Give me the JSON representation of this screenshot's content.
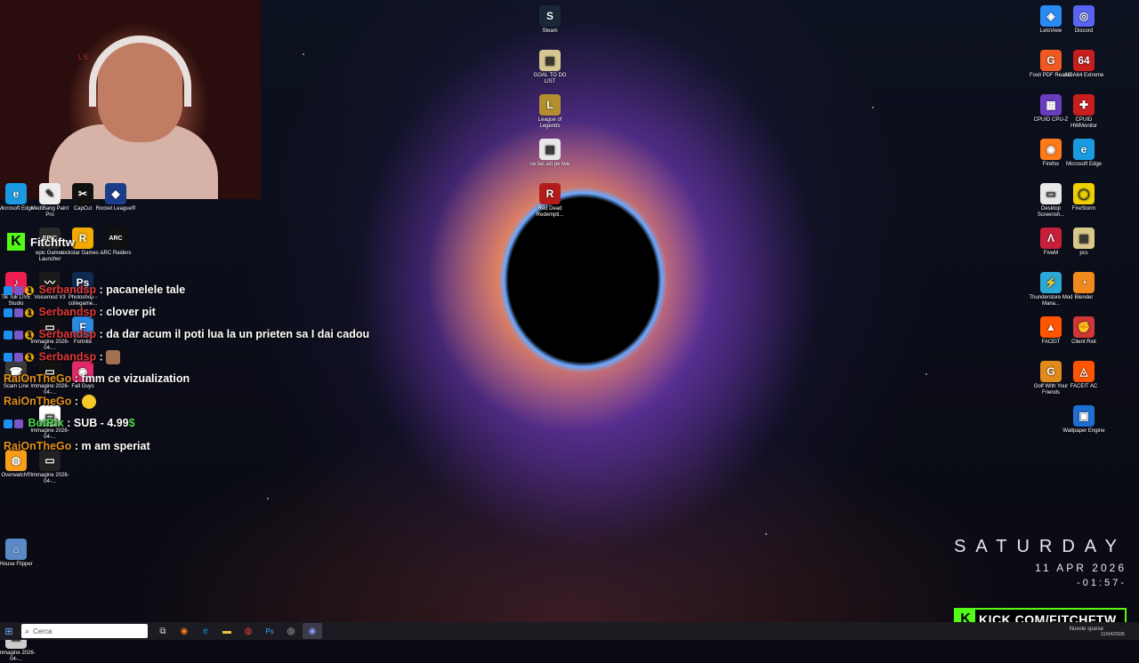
{
  "overlay": {
    "kick_chat_username": "Fitchftw",
    "kick_banner_url": "KICK.COM/FITCHFTW"
  },
  "desktop": {
    "top_center_icons": [
      {
        "label": "Steam",
        "color": "#1b2838",
        "glyph": "S"
      },
      {
        "label": "GOAL TO DO LIST",
        "color": "#d6c690",
        "glyph": "▤"
      },
      {
        "label": "League of Legends",
        "color": "#b38e2e",
        "glyph": "L"
      },
      {
        "label": "ce fac azi pe live",
        "color": "#e8e8e8",
        "glyph": "▤"
      },
      {
        "label": "Red Dead Redempti...",
        "color": "#b31b1b",
        "glyph": "R"
      }
    ],
    "right_col_a": [
      {
        "label": "LetsView",
        "color": "#2a8bf2",
        "glyph": "◈"
      },
      {
        "label": "Foxit PDF Reader",
        "color": "#f05a22",
        "glyph": "G"
      },
      {
        "label": "CPUID CPU-Z",
        "color": "#6a3dbf",
        "glyph": "▦"
      },
      {
        "label": "Firefox",
        "color": "#ff7a18",
        "glyph": "◉"
      },
      {
        "label": "Desktop Screensh...",
        "color": "#e8e8e8",
        "glyph": "▭"
      },
      {
        "label": "FiveM",
        "color": "#c8203a",
        "glyph": "Λ"
      },
      {
        "label": "Thunderstore Mod Mana...",
        "color": "#2aa8d8",
        "glyph": "⚡"
      },
      {
        "label": "FACEIT",
        "color": "#ff5500",
        "glyph": "▲"
      },
      {
        "label": "Golf With Your Friends",
        "color": "#e08a1c",
        "glyph": "G"
      }
    ],
    "right_col_b": [
      {
        "label": "Discord",
        "color": "#5865f2",
        "glyph": "◎"
      },
      {
        "label": "AIDA64 Extreme",
        "color": "#c81e1e",
        "glyph": "64"
      },
      {
        "label": "CPUID HWMonitor",
        "color": "#c81e1e",
        "glyph": "✚"
      },
      {
        "label": "Microsoft Edge",
        "color": "#1a9ae0",
        "glyph": "e"
      },
      {
        "label": "FireStorm",
        "color": "#f0d000",
        "glyph": "◯"
      },
      {
        "label": "pcs",
        "color": "#d8c88a",
        "glyph": "▤"
      },
      {
        "label": "Blender",
        "color": "#f08a1c",
        "glyph": "◔"
      },
      {
        "label": "Client Riot",
        "color": "#d13639",
        "glyph": "✊"
      },
      {
        "label": "FACEIT AC",
        "color": "#ff5500",
        "glyph": "◬"
      },
      {
        "label": "Wallpaper Engine",
        "color": "#1f6ed4",
        "glyph": "▣"
      }
    ],
    "left_col_a": [
      {
        "label": "Microsoft Edge",
        "color": "#1a9ae0",
        "glyph": "e"
      },
      {
        "label": "Tik Tok LIVE Studio",
        "color": "#ee1d52",
        "glyph": "♪"
      },
      {
        "label": "Scam Line",
        "color": "#3a3a3a",
        "glyph": "☎"
      },
      {
        "label": "Overwatch®",
        "color": "#f99e1a",
        "glyph": "◍"
      },
      {
        "label": "House Flipper",
        "color": "#5a8ac6",
        "glyph": "⌂"
      },
      {
        "label": "Immagine 2026-04-...",
        "color": "#cccccc",
        "glyph": "▭"
      }
    ],
    "left_col_b": [
      {
        "label": "MediBang Paint Pro",
        "color": "#eeeeee",
        "glyph": "✎"
      },
      {
        "label": "epic Games Launcher",
        "color": "#2a2a2a",
        "glyph": "EPIC"
      },
      {
        "label": "Voicemod V3",
        "color": "#1a1a1a",
        "glyph": "〰"
      },
      {
        "label": "Immagine 2026-04-...",
        "color": "#111111",
        "glyph": "▭"
      },
      {
        "label": "Immagine 2026-04-...",
        "color": "#111111",
        "glyph": "▭"
      },
      {
        "label": "Immagine 2026-04-...",
        "color": "#ffffff",
        "glyph": "▭"
      },
      {
        "label": "Immagine 2026-04-...",
        "color": "#222222",
        "glyph": "▭"
      }
    ],
    "left_col_c": [
      {
        "label": "CapCut",
        "color": "#111111",
        "glyph": "✂"
      },
      {
        "label": "rockstar Games ...",
        "color": "#f2a900",
        "glyph": "R"
      },
      {
        "label": "Photoshop - collegame...",
        "color": "#0d2b4f",
        "glyph": "Ps"
      },
      {
        "label": "Fortnite",
        "color": "#2a8ae0",
        "glyph": "F"
      },
      {
        "label": "Fall Guys",
        "color": "#e02a6a",
        "glyph": "◉"
      }
    ],
    "left_col_d": [
      {
        "label": "Rocket League®",
        "color": "#1b3d8a",
        "glyph": "◆"
      },
      {
        "label": "ARC Raiders",
        "color": "#111111",
        "glyph": "ARC"
      }
    ]
  },
  "chat": {
    "messages": [
      {
        "user": "Serbandsp",
        "text": ": pacanelele tale",
        "color": "red"
      },
      {
        "user": "Serbandsp",
        "text": ": clover pit",
        "color": "red"
      },
      {
        "user": "Serbandsp",
        "text": ": da dar acum il poti lua la un prieten sa I dai cadou",
        "color": "red"
      },
      {
        "user": "Serbandsp",
        "text": ":",
        "color": "red"
      },
      {
        "user": "RaiOnTheGo",
        "text": ": fmm ce vizualization",
        "color": "orange"
      },
      {
        "user": "RaiOnTheGo",
        "text": ":",
        "color": "orange"
      },
      {
        "user": "BotRix",
        "text": ": SUB - 4.99",
        "color": "green"
      },
      {
        "user": "RaiOnTheGo",
        "text": ": m am speriat",
        "color": "orange"
      }
    ],
    "sub_currency": "$"
  },
  "clock": {
    "day": "SATURDAY",
    "date": "11 APR 2026",
    "time": "-01:57-"
  },
  "taskbar": {
    "search_placeholder": "Cerca",
    "weather": "Nuvole sparse",
    "tray_date": "11/04/2026"
  }
}
